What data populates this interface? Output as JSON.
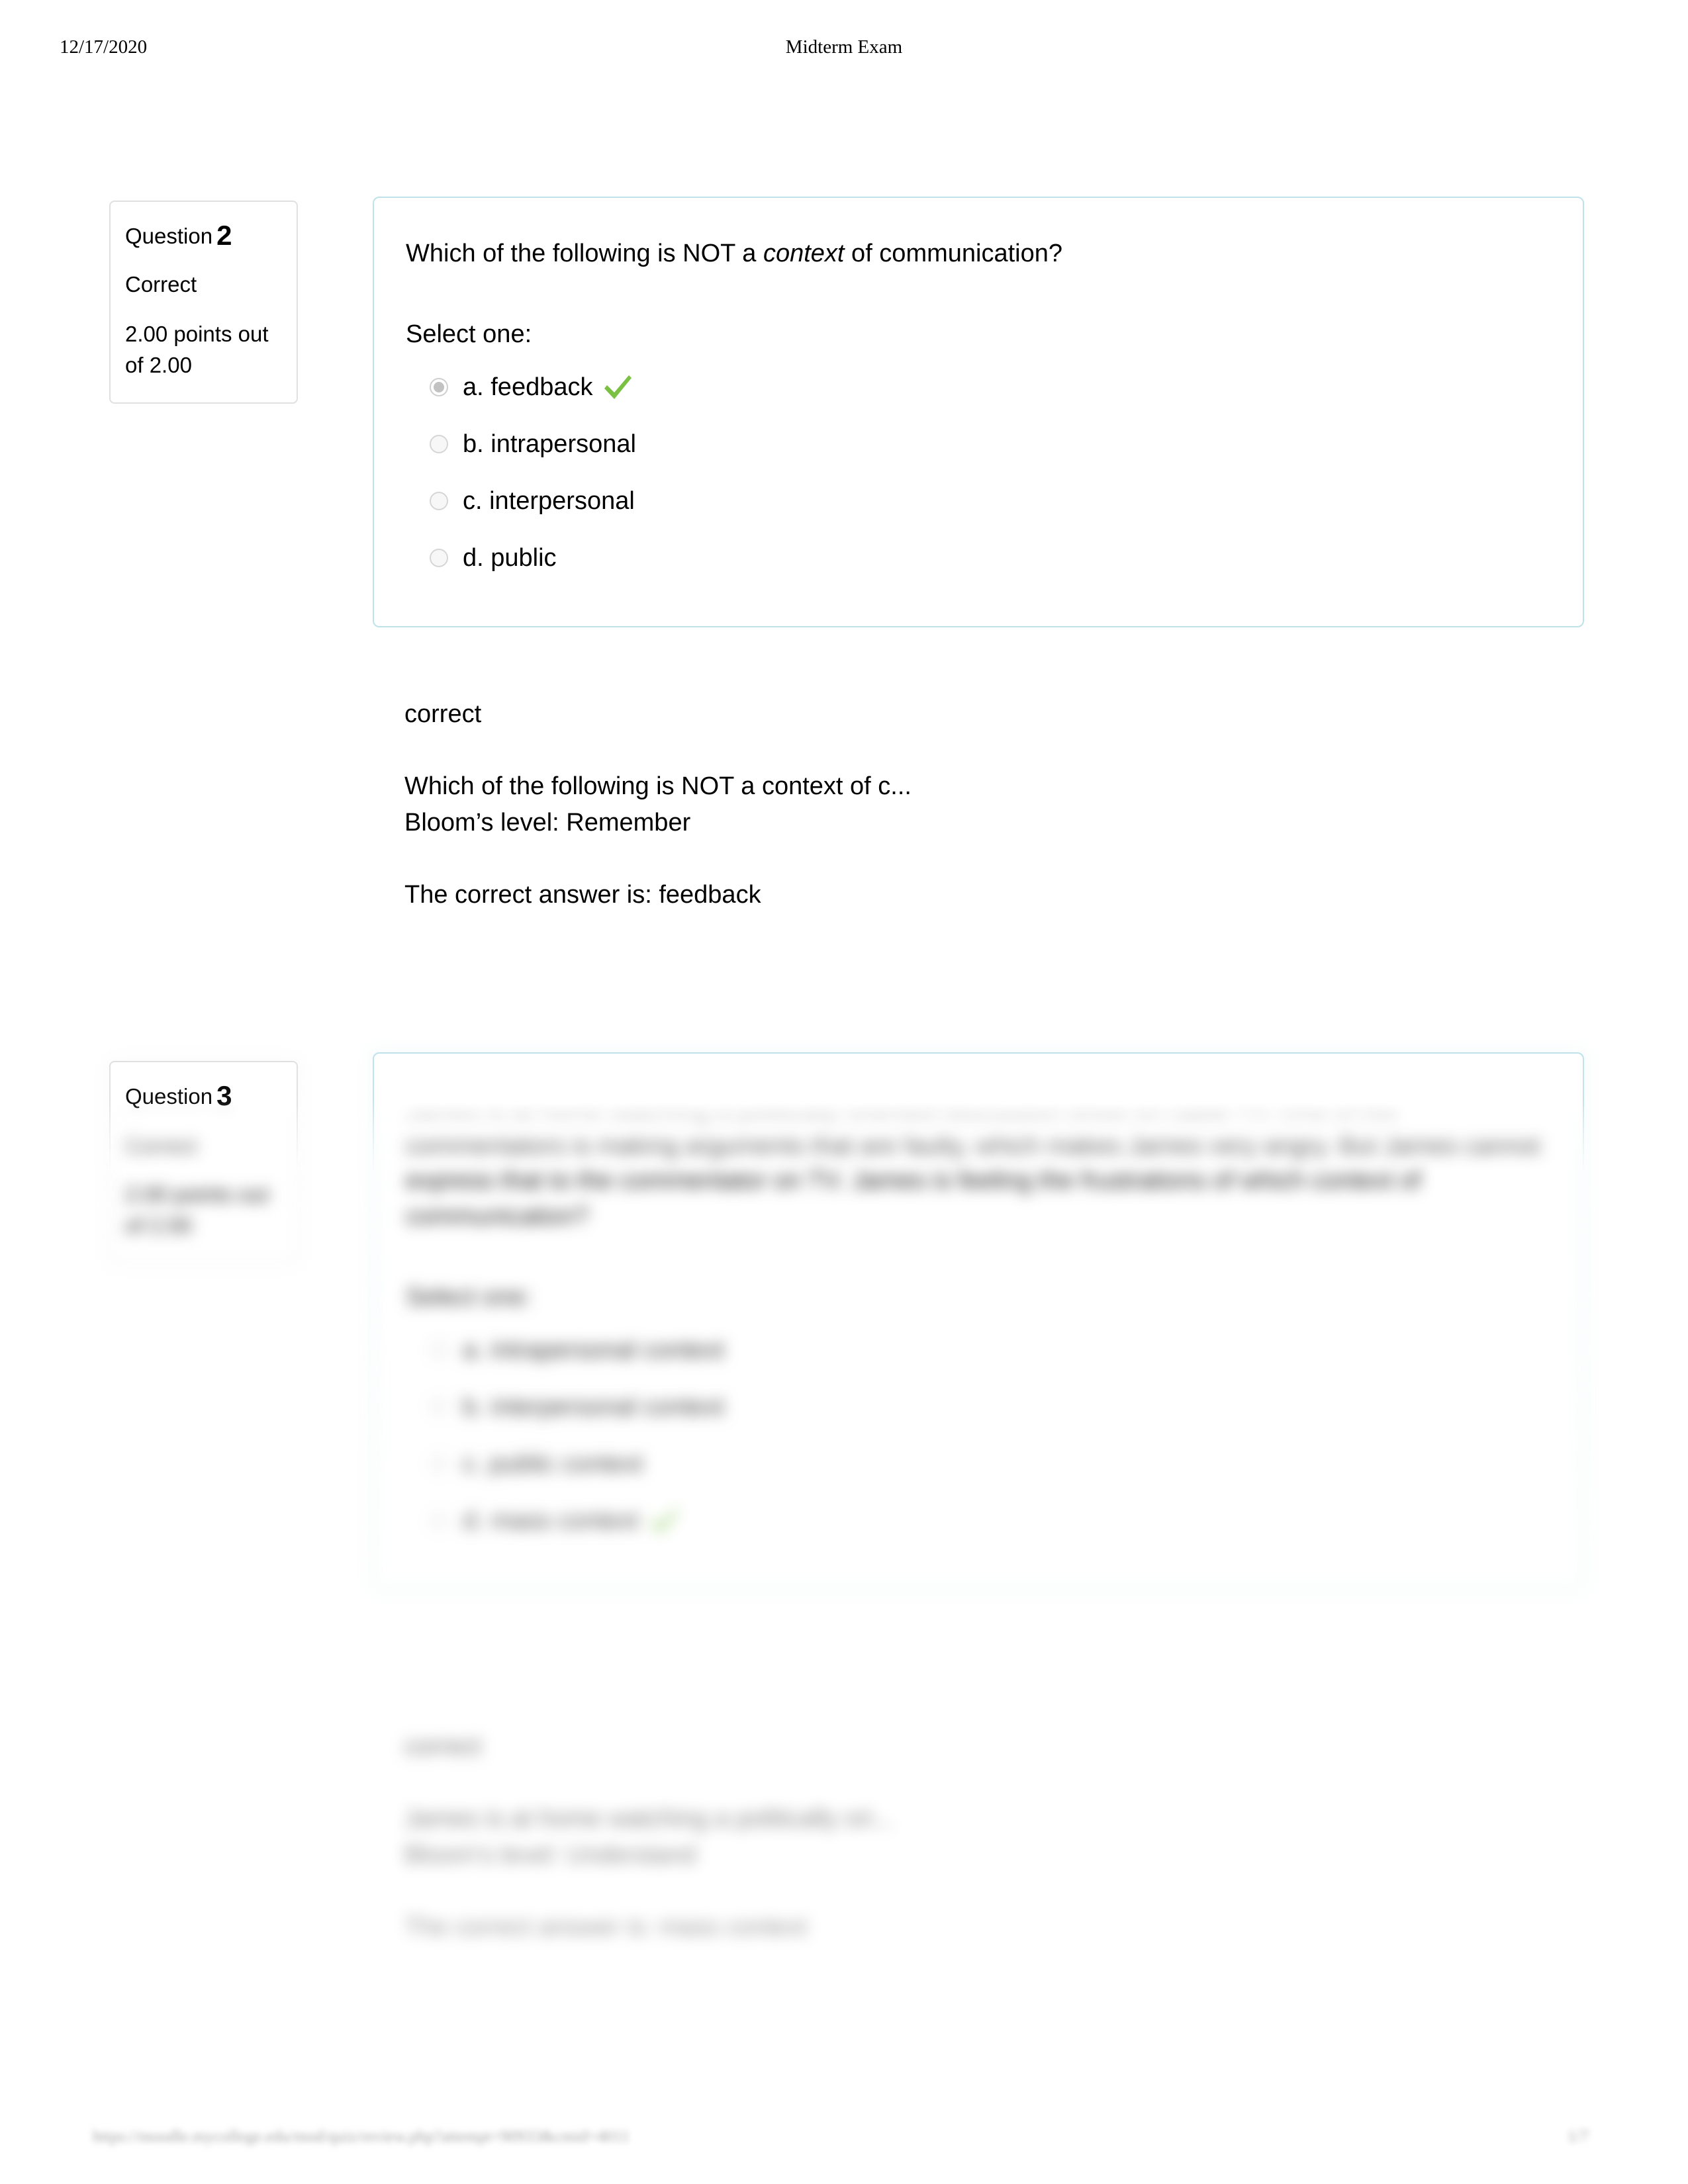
{
  "header": {
    "date": "12/17/2020",
    "title": "Midterm Exam"
  },
  "footer": {
    "url": "https://moodle.mycollege.edu/mod/quiz/review.php?attempt=90933&cmid=4011",
    "page": "1/7"
  },
  "questions": [
    {
      "info": {
        "question_word": "Question",
        "number": "2",
        "status": "Correct",
        "points": "2.00 points out of 2.00"
      },
      "stem_before": "Which of the following is NOT a ",
      "stem_italic": "context",
      "stem_after": " of communication?",
      "select_prompt": "Select one:",
      "options": [
        {
          "label": "a. feedback",
          "selected": true,
          "correct": true
        },
        {
          "label": "b. intrapersonal",
          "selected": false,
          "correct": false
        },
        {
          "label": "c. interpersonal",
          "selected": false,
          "correct": false
        },
        {
          "label": "d. public",
          "selected": false,
          "correct": false
        }
      ],
      "feedback": {
        "verdict": "correct",
        "stem_echo": "Which of the following is NOT a context of c...",
        "bloom": "Bloom’s level: Remember",
        "correct_answer": "The correct answer is: feedback"
      }
    },
    {
      "info": {
        "question_word": "Question",
        "number": "3",
        "status": "Correct",
        "points": "2.00 points out of 2.00"
      },
      "stem_before": "James is at home watching a politically oriented discussion show on cable TV. One of the commentators is making arguments that are faulty, which makes James very angry. But James cannot express that to the commentator on TV. James is feeling the frustrations of which context of communication?",
      "stem_italic": "",
      "stem_after": "",
      "select_prompt": "Select one:",
      "options": [
        {
          "label": "a. intrapersonal context",
          "selected": false,
          "correct": false
        },
        {
          "label": "b. interpersonal context",
          "selected": false,
          "correct": false
        },
        {
          "label": "c. public context",
          "selected": false,
          "correct": false
        },
        {
          "label": "d. mass context",
          "selected": false,
          "correct": true
        }
      ],
      "feedback": {
        "verdict": "correct",
        "stem_echo": "James is at home watching a politically ori...",
        "bloom": "Bloom’s level: Understand",
        "correct_answer": "The correct answer is: mass context"
      }
    }
  ],
  "colors": {
    "card_border": "#bfe2ea",
    "info_border": "#e0e0e0",
    "tick_green": "#7ac143",
    "radio_fill": "#c2c2c2"
  }
}
